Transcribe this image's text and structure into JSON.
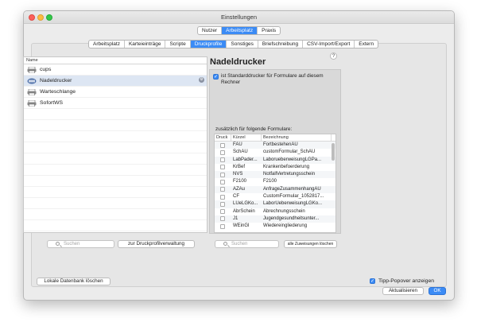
{
  "window": {
    "title": "Einstellungen"
  },
  "top_tabs": [
    {
      "label": "Nutzer",
      "active": false
    },
    {
      "label": "Arbeitsplatz",
      "active": true
    },
    {
      "label": "Praxis",
      "active": false
    }
  ],
  "sub_tabs": [
    {
      "label": "Arbeitsplatz",
      "active": false
    },
    {
      "label": "Karteieinträge",
      "active": false
    },
    {
      "label": "Scripte",
      "active": false
    },
    {
      "label": "Druckprofile",
      "active": true
    },
    {
      "label": "Sonstiges",
      "active": false
    },
    {
      "label": "Briefschreibung",
      "active": false
    },
    {
      "label": "CSV-Import/Export",
      "active": false
    },
    {
      "label": "Extern",
      "active": false
    }
  ],
  "profile_list": {
    "header": "Name",
    "items": [
      {
        "name": "cups",
        "icon": "printer-icon",
        "selected": false
      },
      {
        "name": "Nadeldrucker",
        "icon": "dot-matrix-printer-icon",
        "selected": true
      },
      {
        "name": "Warteschlange",
        "icon": "printer-icon",
        "selected": false
      },
      {
        "name": "SofortWS",
        "icon": "printer-icon",
        "selected": false
      }
    ],
    "badge": "⚙"
  },
  "detail": {
    "heading": "Nadeldrucker",
    "help": "?",
    "standard_checkbox_label": "ist Standarddrucker für Formulare auf diesem Rechner",
    "standard_checked": true,
    "forms_label": "zusätzlich für folgende Formulare:",
    "columns": [
      "Druck",
      "Kürzel",
      "Bezeichnung"
    ],
    "rows": [
      {
        "kuerzel": "FAU",
        "bezeichnung": "FortbestehenAU"
      },
      {
        "kuerzel": "SchAU",
        "bezeichnung": "customFormular_SchAU"
      },
      {
        "kuerzel": "LabPader...",
        "bezeichnung": "LaborueberweisungLGPa..."
      },
      {
        "kuerzel": "KrBef",
        "bezeichnung": "Krankenbefoerderung"
      },
      {
        "kuerzel": "NVS",
        "bezeichnung": "NotfallVertretungsschein"
      },
      {
        "kuerzel": "F2100",
        "bezeichnung": "F2100"
      },
      {
        "kuerzel": "AZAu",
        "bezeichnung": "AnfrageZusammenhangAU"
      },
      {
        "kuerzel": "CF",
        "bezeichnung": "CustomFormular_1052817..."
      },
      {
        "kuerzel": "LUeLGKo...",
        "bezeichnung": "LaborUeberweisungLGKo..."
      },
      {
        "kuerzel": "AbrSchein",
        "bezeichnung": "Abrechnungsschein"
      },
      {
        "kuerzel": "J1",
        "bezeichnung": "Jugendgesundheitsunter..."
      },
      {
        "kuerzel": "WEinGl",
        "bezeichnung": "Wiedereingliederung"
      }
    ]
  },
  "bottom": {
    "search_left_placeholder": "Suchen",
    "profile_mgmt_button": "zur Druckprofilverwaltung",
    "search_right_placeholder": "Suchen",
    "remove_assignments_button": "alle Zuweisungen löschen",
    "delete_local_db_button": "Lokale Datenbank löschen",
    "tipp_label": "Tipp-Popover anzeigen",
    "tipp_checked": true,
    "refresh_button": "Aktualisieren",
    "ok_button": "OK"
  },
  "colors": {
    "accent": "#3b8bf5",
    "selection": "#dde6f3"
  }
}
